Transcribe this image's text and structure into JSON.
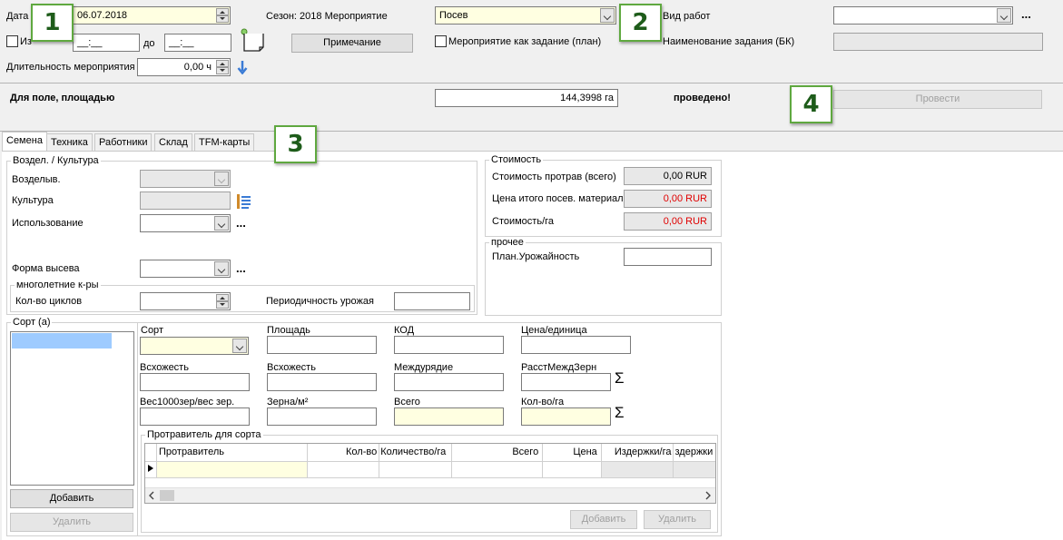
{
  "header": {
    "date_label": "Дата",
    "date_value": "06.07.2018",
    "from_label": "Из",
    "time_from": "__:__",
    "to_label": "до",
    "time_to": "__:__",
    "duration_label": "Длительность мероприятия",
    "duration_value": "0,00 ч",
    "season_label": "Сезон: 2018 Мероприятие",
    "event_value": "Посев",
    "note_button": "Примечание",
    "as_task_label": "Мероприятие как задание (план)",
    "work_type_label": "Вид работ",
    "work_type_value": "",
    "task_name_label": "Наименование задания (БК)",
    "task_name_value": "",
    "dots": "..."
  },
  "field_bar": {
    "label": "Для поле, площадью",
    "area_value": "144,3998 га",
    "status": "проведено!",
    "conduct_button": "Провести"
  },
  "callouts": [
    "1",
    "2",
    "3",
    "4"
  ],
  "tabs": [
    {
      "label": "Семена",
      "active": true
    },
    {
      "label": "Техника",
      "active": false
    },
    {
      "label": "Работники",
      "active": false
    },
    {
      "label": "Склад",
      "active": false
    },
    {
      "label": "TFM-карты",
      "active": false
    }
  ],
  "crop_group": {
    "title": "Воздел. / Культура",
    "cultivated_label": "Возделыв.",
    "culture_label": "Культура",
    "usage_label": "Использование",
    "sowing_form_label": "Форма высева",
    "perennial_title": "многолетние к-ры",
    "cycles_label": "Кол-во циклов",
    "periodicity_label": "Периодичность урожая"
  },
  "cost_group": {
    "title": "Стоимость",
    "rows": [
      {
        "label": "Стоимость протрав (всего)",
        "value": "0,00 RUR",
        "red": false
      },
      {
        "label": "Цена итого посев. материал",
        "value": "0,00 RUR",
        "red": true
      },
      {
        "label": "Стоимость/га",
        "value": "0,00 RUR",
        "red": true
      }
    ]
  },
  "other_group": {
    "title": "прочее",
    "yield_label": "План.Урожайность"
  },
  "variety_group": {
    "title": "Сорт (а)",
    "add_button": "Добавить",
    "delete_button": "Удалить",
    "fields": {
      "variety": "Сорт",
      "area": "Площадь",
      "code": "КОД",
      "unit_price": "Цена/единица",
      "germination1": "Всхожесть",
      "germination2": "Всхожесть",
      "row_spacing": "Междурядие",
      "seed_spacing": "РасстМеждЗерн",
      "weight1000": "Вес1000зер/вес зер.",
      "grains_m2": "Зерна/м²",
      "total": "Всего",
      "qty_ha": "Кол-во/га"
    },
    "sigma": "Σ"
  },
  "treatment_group": {
    "title": "Протравитель для сорта",
    "columns": [
      "Протравитель",
      "Кол-во",
      "Количество/га",
      "Всего",
      "Цена",
      "Издержки/га",
      "здержки"
    ],
    "add_button": "Добавить",
    "delete_button": "Удалить"
  }
}
